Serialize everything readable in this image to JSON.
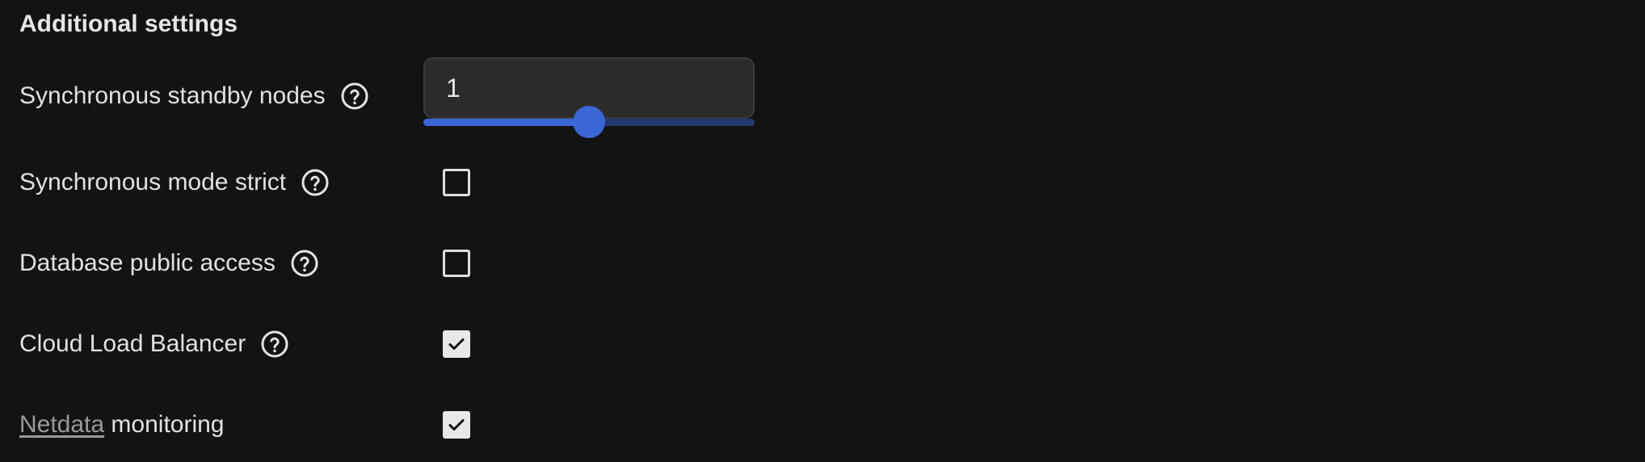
{
  "section": {
    "title": "Additional settings"
  },
  "settings": {
    "standby_nodes": {
      "label": "Synchronous standby nodes",
      "value": "1",
      "slider_fraction": 0.5,
      "help_icon": "help-circle-icon"
    },
    "mode_strict": {
      "label": "Synchronous mode strict",
      "checked": false,
      "help_icon": "help-circle-icon"
    },
    "public_access": {
      "label": "Database public access",
      "checked": false,
      "help_icon": "help-circle-icon"
    },
    "load_balancer": {
      "label": "Cloud Load Balancer",
      "checked": true,
      "help_icon": "help-circle-icon"
    },
    "netdata": {
      "link_text": "Netdata",
      "label_suffix": " monitoring",
      "checked": true
    }
  },
  "colors": {
    "background": "#131313",
    "accent": "#3a66d6",
    "track": "#223a6e"
  }
}
